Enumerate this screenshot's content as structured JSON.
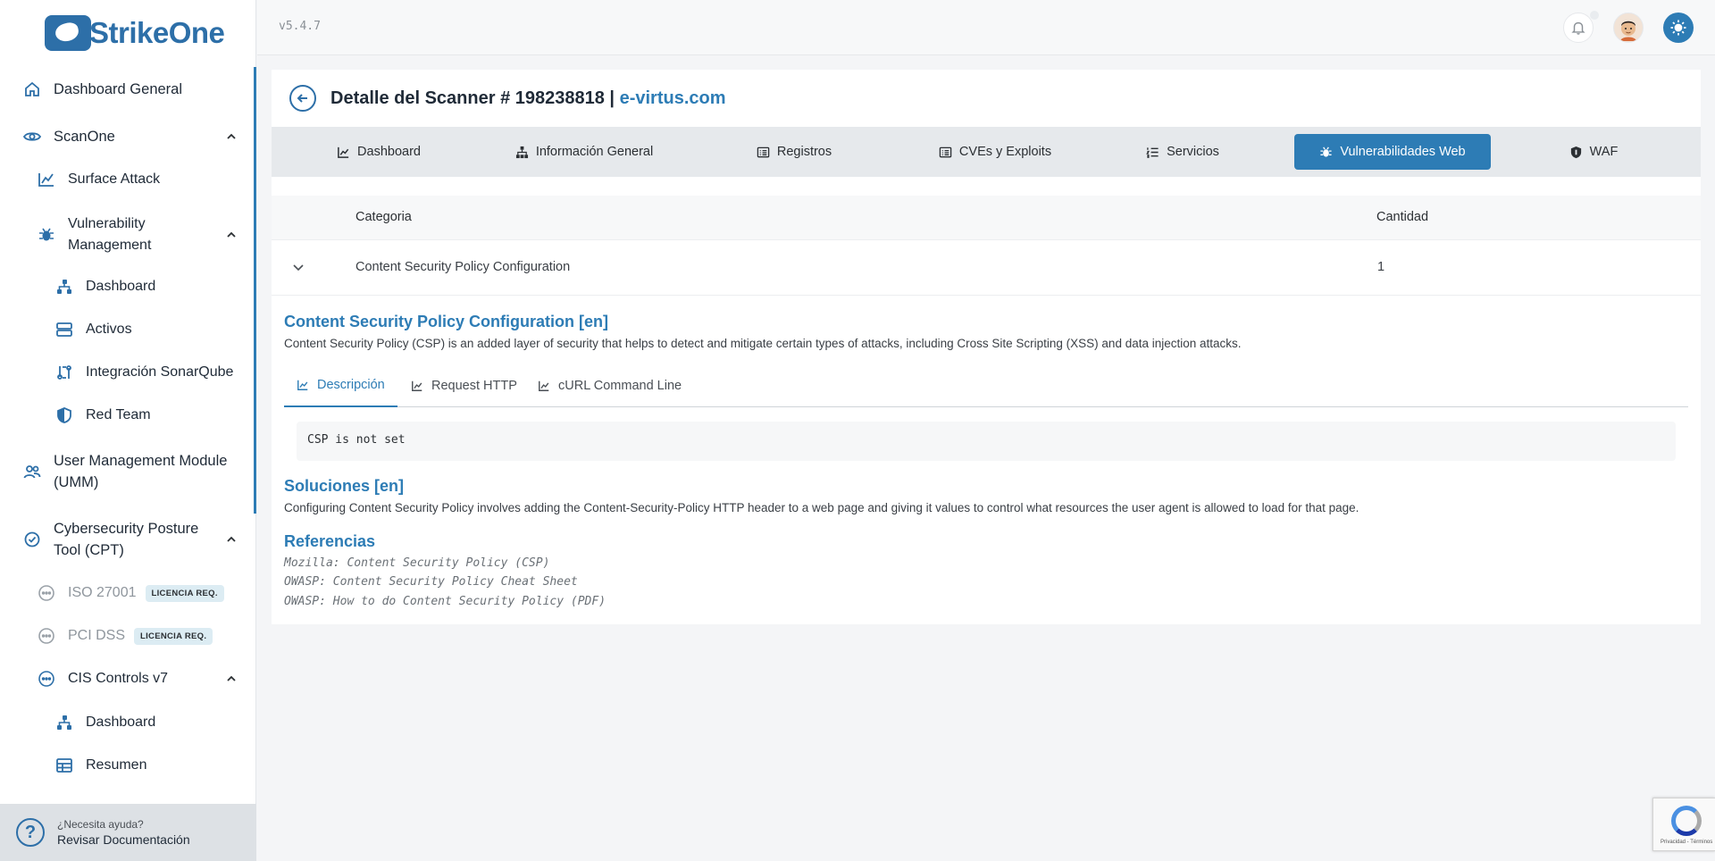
{
  "app": {
    "logo_text": "StrikeOne",
    "version": "v5.4.7"
  },
  "sidebar": {
    "dashboard_general": "Dashboard General",
    "scanone": "ScanOne",
    "surface_attack": "Surface Attack",
    "vuln_mgmt": "Vulnerability Management",
    "vm_dashboard": "Dashboard",
    "activos": "Activos",
    "sonarqube": "Integración SonarQube",
    "red_team": "Red Team",
    "umm": "User Management Module (UMM)",
    "cpt": "Cybersecurity Posture Tool (CPT)",
    "iso": "ISO 27001",
    "pci": "PCI DSS",
    "license_badge": "LICENCIA REQ.",
    "cis": "CIS Controls v7",
    "cis_dashboard": "Dashboard",
    "cis_resumen": "Resumen"
  },
  "help": {
    "question": "¿Necesita ayuda?",
    "link": "Revisar Documentación"
  },
  "header": {
    "title_prefix": "Detalle del Scanner # 198238818 | ",
    "domain": "e-virtus.com"
  },
  "tabs": [
    {
      "label": "Dashboard",
      "icon": "chart-line-icon"
    },
    {
      "label": "Información General",
      "icon": "sitemap-icon"
    },
    {
      "label": "Registros",
      "icon": "list-alt-icon"
    },
    {
      "label": "CVEs y Exploits",
      "icon": "list-alt-icon"
    },
    {
      "label": "Servicios",
      "icon": "list-ol-icon"
    },
    {
      "label": "Vulnerabilidades Web",
      "icon": "bug-icon",
      "active": true
    },
    {
      "label": "WAF",
      "icon": "shield-icon"
    }
  ],
  "table": {
    "headers": [
      "Categoria",
      "Cantidad"
    ],
    "rows": [
      {
        "categoria": "Content Security Policy Configuration",
        "cantidad": "1"
      }
    ]
  },
  "detail": {
    "title": "Content Security Policy Configuration [en]",
    "description": "Content Security Policy (CSP) is an added layer of security that helps to detect and mitigate certain types of attacks, including Cross Site Scripting (XSS) and data injection attacks.",
    "subtabs": [
      "Descripción",
      "Request HTTP",
      "cURL Command Line"
    ],
    "code": "CSP is not set",
    "solutions_title": "Soluciones [en]",
    "solutions_text": "Configuring Content Security Policy involves adding the Content-Security-Policy HTTP header to a web page and giving it values to control what resources the user agent is allowed to load for that page.",
    "references_title": "Referencias",
    "references": [
      "Mozilla: Content Security Policy (CSP)",
      "OWASP: Content Security Policy Cheat Sheet",
      "OWASP: How to do Content Security Policy (PDF)"
    ]
  },
  "recaptcha": {
    "text": "Privacidad - Términos"
  },
  "colors": {
    "accent": "#2d7cb5",
    "brand": "#2d6fa8"
  }
}
